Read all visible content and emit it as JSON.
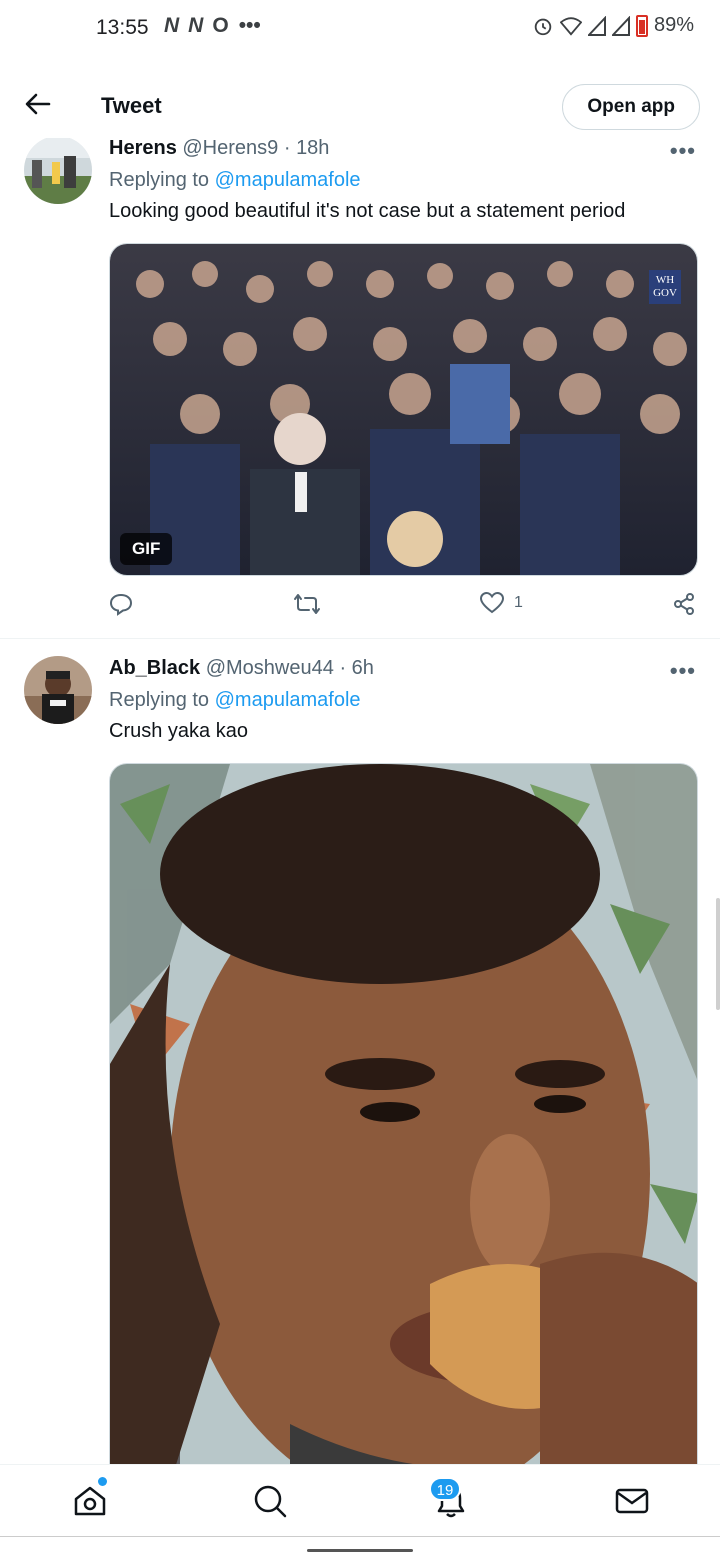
{
  "status_bar": {
    "time": "13:55",
    "left_icons": [
      "N",
      "N",
      "O",
      "•••"
    ],
    "battery": "89%"
  },
  "header": {
    "title": "Tweet",
    "open_app": "Open app"
  },
  "tweets": [
    {
      "name": "Herens",
      "handle": "@Herens9",
      "time": "18h",
      "replying_label": "Replying to",
      "replying_to": "@mapulamafole",
      "text": "Looking good beautiful it's not case but a statement period",
      "media_badge": "GIF",
      "media_logo": "WH GOV",
      "likes": "1"
    },
    {
      "name": "Ab_Black",
      "handle": "@Moshweu44",
      "time": "6h",
      "replying_label": "Replying to",
      "replying_to": "@mapulamafole",
      "text": "Crush yaka kao"
    }
  ],
  "bottom_nav": {
    "notifications_count": "19"
  },
  "colors": {
    "accent": "#1d9bf0",
    "text": "#0f1419",
    "muted": "#536471"
  }
}
